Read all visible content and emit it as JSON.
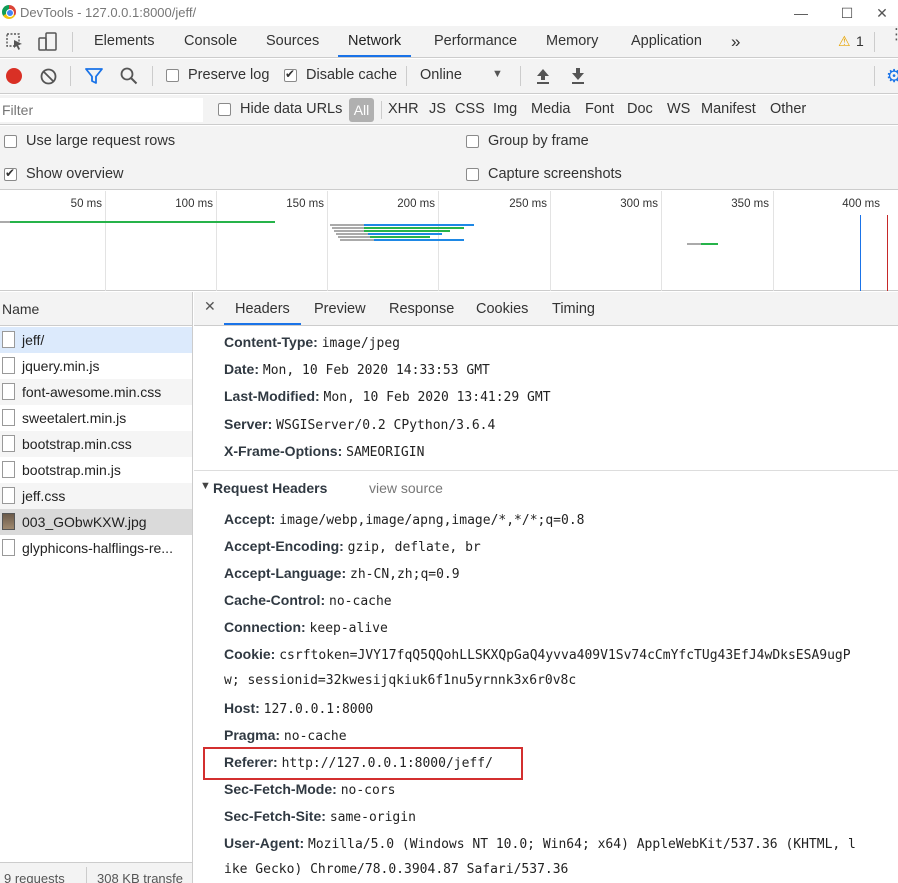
{
  "window": {
    "title": "DevTools - 127.0.0.1:8000/jeff/"
  },
  "tabs": [
    "Elements",
    "Console",
    "Sources",
    "Network",
    "Performance",
    "Memory",
    "Application"
  ],
  "active_tab": "Network",
  "warnings": {
    "count": "1"
  },
  "toolbar": {
    "preserve_log": "Preserve log",
    "disable_cache": "Disable cache",
    "throttle": "Online"
  },
  "filter": {
    "placeholder": "Filter",
    "hide_data_urls": "Hide data URLs",
    "types": [
      "All",
      "XHR",
      "JS",
      "CSS",
      "Img",
      "Media",
      "Font",
      "Doc",
      "WS",
      "Manifest",
      "Other"
    ]
  },
  "settings": {
    "large_rows": "Use large request rows",
    "show_overview": "Show overview",
    "group_by_frame": "Group by frame",
    "capture_screenshots": "Capture screenshots"
  },
  "overview": {
    "ticks": [
      "50 ms",
      "100 ms",
      "150 ms",
      "200 ms",
      "250 ms",
      "300 ms",
      "350 ms",
      "400 ms"
    ]
  },
  "requests": {
    "header": "Name",
    "items": [
      "jeff/",
      "jquery.min.js",
      "font-awesome.min.css",
      "sweetalert.min.js",
      "bootstrap.min.css",
      "bootstrap.min.js",
      "jeff.css",
      "003_GObwKXW.jpg",
      "glyphicons-halflings-re..."
    ],
    "summary_requests": "9 requests",
    "summary_transferred": "308 KB transfe"
  },
  "detail_tabs": [
    "Headers",
    "Preview",
    "Response",
    "Cookies",
    "Timing"
  ],
  "response_headers": [
    {
      "k": "Content-Type:",
      "v": "image/jpeg"
    },
    {
      "k": "Date:",
      "v": "Mon, 10 Feb 2020 14:33:53 GMT"
    },
    {
      "k": "Last-Modified:",
      "v": "Mon, 10 Feb 2020 13:41:29 GMT"
    },
    {
      "k": "Server:",
      "v": "WSGIServer/0.2 CPython/3.6.4"
    },
    {
      "k": "X-Frame-Options:",
      "v": "SAMEORIGIN"
    }
  ],
  "request_section": {
    "title": "Request Headers",
    "view_source": "view source"
  },
  "request_headers": [
    {
      "k": "Accept:",
      "v": "image/webp,image/apng,image/*,*/*;q=0.8"
    },
    {
      "k": "Accept-Encoding:",
      "v": "gzip, deflate, br"
    },
    {
      "k": "Accept-Language:",
      "v": "zh-CN,zh;q=0.9"
    },
    {
      "k": "Cache-Control:",
      "v": "no-cache"
    },
    {
      "k": "Connection:",
      "v": "keep-alive"
    },
    {
      "k": "Cookie:",
      "v": "csrftoken=JVY17fqQ5QQohLLSKXQpGaQ4yvva409V1Sv74cCmYfcTUg43EfJ4wDksESA9ugP"
    },
    {
      "k": "",
      "v": "w; sessionid=32kwesijqkiuk6f1nu5yrnnk3x6r0v8c"
    },
    {
      "k": "Host:",
      "v": "127.0.0.1:8000"
    },
    {
      "k": "Pragma:",
      "v": "no-cache"
    },
    {
      "k": "Referer:",
      "v": "http://127.0.0.1:8000/jeff/"
    },
    {
      "k": "Sec-Fetch-Mode:",
      "v": "no-cors"
    },
    {
      "k": "Sec-Fetch-Site:",
      "v": "same-origin"
    },
    {
      "k": "User-Agent:",
      "v": "Mozilla/5.0 (Windows NT 10.0; Win64; x64) AppleWebKit/537.36 (KHTML, l"
    },
    {
      "k": "",
      "v": "ike Gecko) Chrome/78.0.3904.87 Safari/537.36"
    }
  ],
  "colors": {
    "accent": "#1a73e8",
    "record": "#d93025",
    "highlight_box": "#d32f2f"
  }
}
